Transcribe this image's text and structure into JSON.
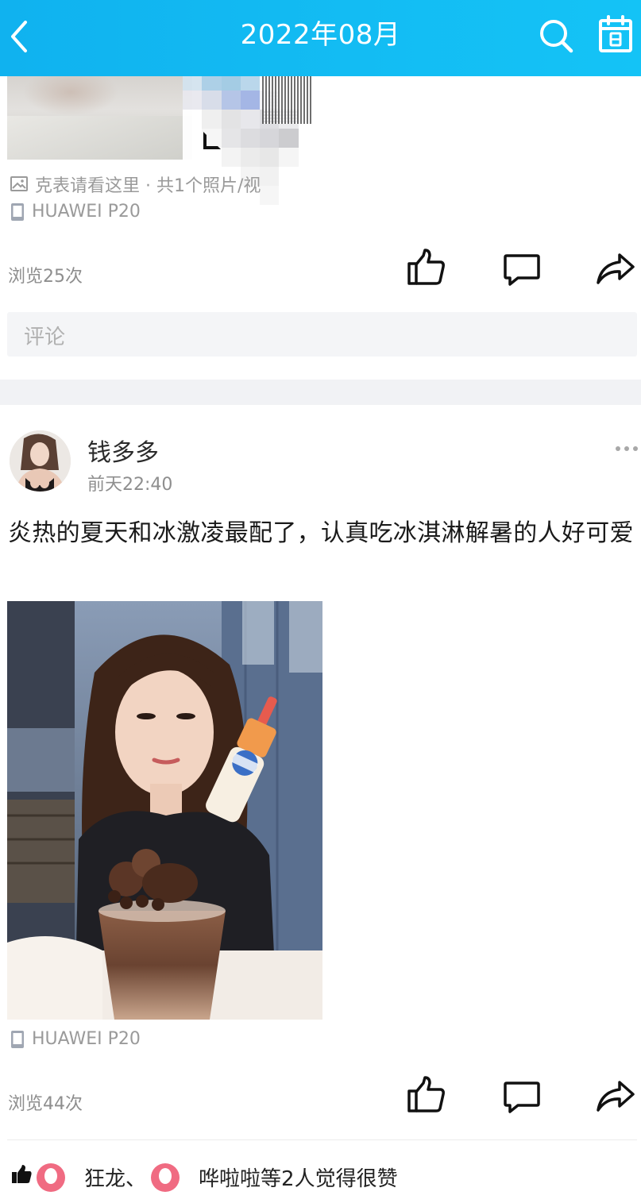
{
  "header": {
    "title": "2022年08月",
    "bg_color": "#13bcf3",
    "icons": [
      "back-arrow-icon",
      "search-icon",
      "calendar-icon"
    ]
  },
  "post1": {
    "photo_meta": "克表请看这里 · 共1个照片/视",
    "device": "HUAWEI P20",
    "views": "浏览25次",
    "comment_placeholder": "评论"
  },
  "post2": {
    "username": "钱多多",
    "time": "前天22:40",
    "text": "炎热的夏天和冰激凌最配了，认真吃冰淇淋解暑的人好可爱",
    "device": "HUAWEI P20",
    "views": "浏览44次",
    "likes": {
      "name1": "狂龙",
      "separator": "、",
      "suffix": "哗啦啦等2人觉得很赞"
    }
  },
  "colors": {
    "accent": "#13bcf3",
    "meta_gray": "#9a9a9a",
    "comment_box": "#f4f5f7",
    "avatar_pink": "#f06b82"
  }
}
